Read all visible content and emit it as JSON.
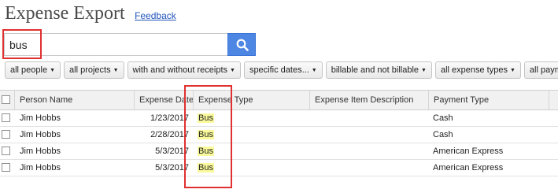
{
  "header": {
    "title": "Expense Export",
    "feedback_label": "Feedback"
  },
  "search": {
    "value": "bus",
    "icon": "search-icon"
  },
  "filters": [
    "all people",
    "all projects",
    "with and without receipts",
    "specific dates...",
    "billable and not billable",
    "all expense types",
    "all paym"
  ],
  "table": {
    "columns": [
      "Person Name",
      "Expense Date",
      "Expense Type",
      "Expense Item Description",
      "Payment Type"
    ],
    "rows": [
      {
        "person": "Jim Hobbs",
        "date": "1/23/2017",
        "type": "Bus",
        "description": "",
        "payment": "Cash"
      },
      {
        "person": "Jim Hobbs",
        "date": "2/28/2017",
        "type": "Bus",
        "description": "",
        "payment": "Cash"
      },
      {
        "person": "Jim Hobbs",
        "date": "5/3/2017",
        "type": "Bus",
        "description": "",
        "payment": "American Express"
      },
      {
        "person": "Jim Hobbs",
        "date": "5/3/2017",
        "type": "Bus",
        "description": "",
        "payment": "American Express"
      }
    ]
  },
  "colors": {
    "search_button": "#4d86e3",
    "highlight": "#fafa9c",
    "annotation": "#e03030"
  }
}
